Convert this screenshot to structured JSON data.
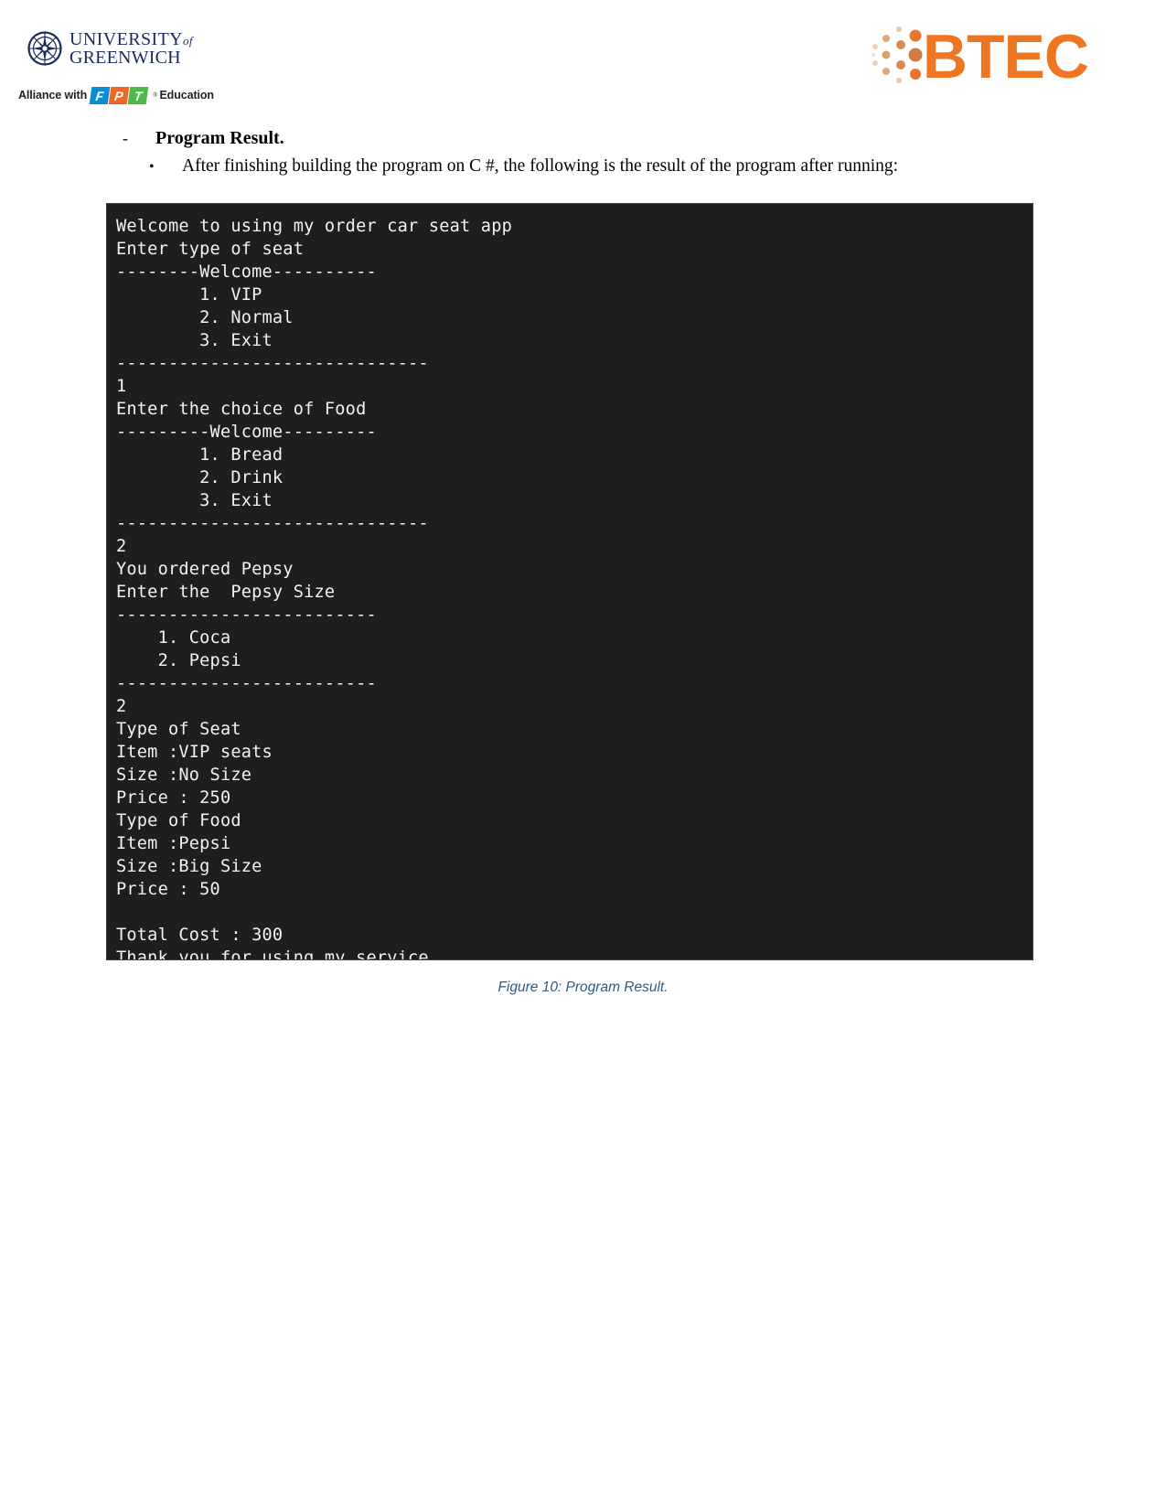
{
  "header": {
    "university": {
      "logo_icon": "compass-rose-icon",
      "line1": "UNIVERSITY",
      "line1_suffix": "of",
      "line2": "GREENWICH"
    },
    "alliance": {
      "prefix": "Alliance with",
      "mark_letters": [
        "F",
        "P",
        "T"
      ],
      "registered": "®",
      "suffix": "Education"
    },
    "btec": {
      "dots_icon": "btec-dot-cluster-icon",
      "wordmark": "BTEC"
    }
  },
  "content": {
    "dash_marker": "-",
    "section_heading": "Program Result.",
    "bullet_marker": "•",
    "bullet_text": "After finishing building the program on C #, the following is the result of the program after running:"
  },
  "console": {
    "lines": [
      "Welcome to using my order car seat app",
      "Enter type of seat",
      "--------Welcome----------",
      "        1. VIP",
      "        2. Normal",
      "        3. Exit",
      "------------------------------",
      "1",
      "Enter the choice of Food",
      "---------Welcome---------",
      "        1. Bread",
      "        2. Drink",
      "        3. Exit",
      "------------------------------",
      "2",
      "You ordered Pepsy",
      "Enter the  Pepsy Size",
      "-------------------------",
      "    1. Coca",
      "    2. Pepsi",
      "-------------------------",
      "2",
      "Type of Seat",
      "Item :VIP seats",
      "Size :No Size",
      "Price : 250",
      "Type of Food",
      "Item :Pepsi",
      "Size :Big Size",
      "Price : 50",
      "",
      "Total Cost : 300",
      "Thank you for using my service"
    ],
    "background_color": "#1e1e1e",
    "text_color": "#f2f2f2"
  },
  "caption": {
    "text": "Figure 10: Program Result.",
    "color": "#2e5a86"
  }
}
